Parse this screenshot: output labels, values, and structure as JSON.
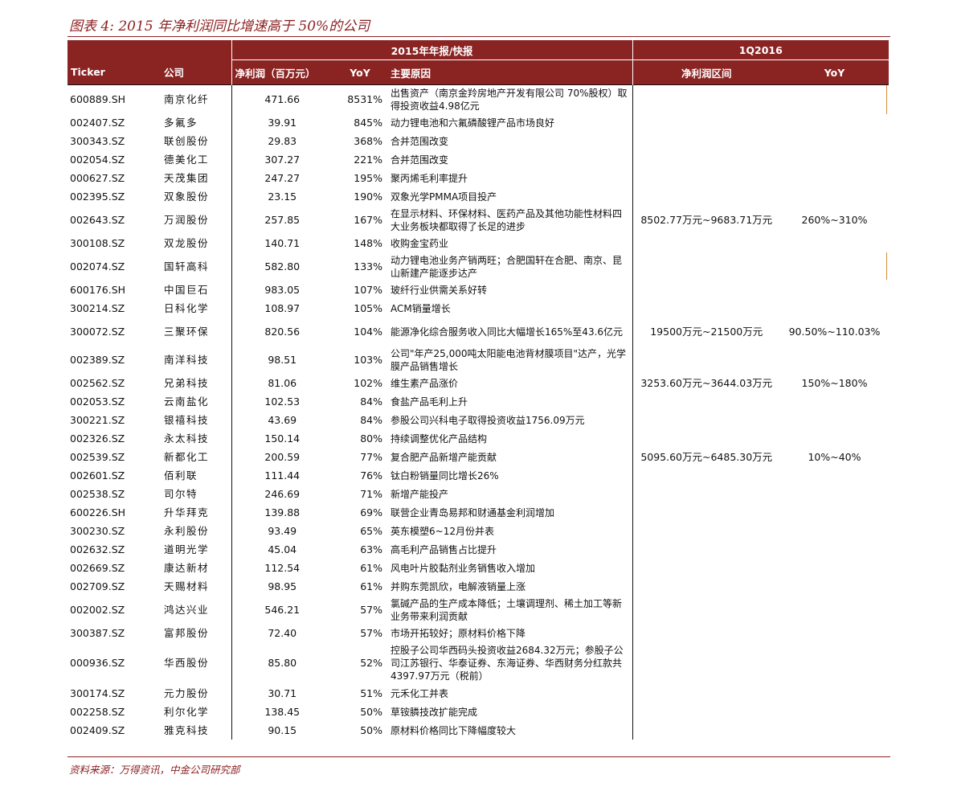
{
  "title": "图表 4: 2015 年净利润同比增速高于 50%的公司",
  "header": {
    "group_2015": "2015年年报/快报",
    "group_1q2016": "1Q2016",
    "col_ticker": "Ticker",
    "col_company": "公司",
    "col_net_profit": "净利润（百万元）",
    "col_yoy": "YoY",
    "col_reason": "主要原因",
    "col_range": "净利润区间",
    "col_q1_yoy": "YoY"
  },
  "rows": [
    {
      "ticker": "600889.SH",
      "name": "南京化纤",
      "profit": "471.66",
      "yoy": "8531%",
      "reason": "出售资产（南京金羚房地产开发有限公司 70%股权）取得投资收益4.98亿元",
      "range": "",
      "q1yoy": ""
    },
    {
      "ticker": "002407.SZ",
      "name": "多氟多",
      "profit": "39.91",
      "yoy": "845%",
      "reason": "动力锂电池和六氟磷酸锂产品市场良好",
      "range": "",
      "q1yoy": ""
    },
    {
      "ticker": "300343.SZ",
      "name": "联创股份",
      "profit": "29.83",
      "yoy": "368%",
      "reason": "合并范围改变",
      "range": "",
      "q1yoy": ""
    },
    {
      "ticker": "002054.SZ",
      "name": "德美化工",
      "profit": "307.27",
      "yoy": "221%",
      "reason": "合并范围改变",
      "range": "",
      "q1yoy": ""
    },
    {
      "ticker": "000627.SZ",
      "name": "天茂集团",
      "profit": "247.27",
      "yoy": "195%",
      "reason": "聚丙烯毛利率提升",
      "range": "",
      "q1yoy": ""
    },
    {
      "ticker": "002395.SZ",
      "name": "双象股份",
      "profit": "23.15",
      "yoy": "190%",
      "reason": "双象光学PMMA项目投产",
      "range": "",
      "q1yoy": ""
    },
    {
      "ticker": "002643.SZ",
      "name": "万润股份",
      "profit": "257.85",
      "yoy": "167%",
      "reason": "在显示材料、环保材料、医药产品及其他功能性材料四大业务板块都取得了长足的进步",
      "range": "8502.77万元~9683.71万元",
      "q1yoy": "260%~310%"
    },
    {
      "ticker": "300108.SZ",
      "name": "双龙股份",
      "profit": "140.71",
      "yoy": "148%",
      "reason": "收购金宝药业",
      "range": "",
      "q1yoy": ""
    },
    {
      "ticker": "002074.SZ",
      "name": "国轩高科",
      "profit": "582.80",
      "yoy": "133%",
      "reason": "动力锂电池业务产销两旺；合肥国轩在合肥、南京、昆山新建产能逐步达产",
      "range": "",
      "q1yoy": ""
    },
    {
      "ticker": "600176.SH",
      "name": "中国巨石",
      "profit": "983.05",
      "yoy": "107%",
      "reason": "玻纤行业供需关系好转",
      "range": "",
      "q1yoy": ""
    },
    {
      "ticker": "300214.SZ",
      "name": "日科化学",
      "profit": "108.97",
      "yoy": "105%",
      "reason": "ACM销量增长",
      "range": "",
      "q1yoy": ""
    },
    {
      "ticker": "300072.SZ",
      "name": "三聚环保",
      "profit": "820.56",
      "yoy": "104%",
      "reason": "能源净化综合服务收入同比大幅增长165%至43.6亿元",
      "range": "19500万元~21500万元",
      "q1yoy": "90.50%~110.03%"
    },
    {
      "ticker": "002389.SZ",
      "name": "南洋科技",
      "profit": "98.51",
      "yoy": "103%",
      "reason": "公司\"年产25,000吨太阳能电池背材膜项目\"达产，光学膜产品销售增长",
      "range": "",
      "q1yoy": ""
    },
    {
      "ticker": "002562.SZ",
      "name": "兄弟科技",
      "profit": "81.06",
      "yoy": "102%",
      "reason": "维生素产品涨价",
      "range": "3253.60万元~3644.03万元",
      "q1yoy": "150%~180%"
    },
    {
      "ticker": "002053.SZ",
      "name": "云南盐化",
      "profit": "102.53",
      "yoy": "84%",
      "reason": "食盐产品毛利上升",
      "range": "",
      "q1yoy": ""
    },
    {
      "ticker": "300221.SZ",
      "name": "银禧科技",
      "profit": "43.69",
      "yoy": "84%",
      "reason": "参股公司兴科电子取得投资收益1756.09万元",
      "range": "",
      "q1yoy": ""
    },
    {
      "ticker": "002326.SZ",
      "name": "永太科技",
      "profit": "150.14",
      "yoy": "80%",
      "reason": "持续调整优化产品结构",
      "range": "",
      "q1yoy": ""
    },
    {
      "ticker": "002539.SZ",
      "name": "新都化工",
      "profit": "200.59",
      "yoy": "77%",
      "reason": "复合肥产品新增产能贡献",
      "range": "5095.60万元~6485.30万元",
      "q1yoy": "10%~40%"
    },
    {
      "ticker": "002601.SZ",
      "name": "佰利联",
      "profit": "111.44",
      "yoy": "76%",
      "reason": "钛白粉销量同比增长26%",
      "range": "",
      "q1yoy": ""
    },
    {
      "ticker": "002538.SZ",
      "name": "司尔特",
      "profit": "246.69",
      "yoy": "71%",
      "reason": "新增产能投产",
      "range": "",
      "q1yoy": ""
    },
    {
      "ticker": "600226.SH",
      "name": "升华拜克",
      "profit": "139.88",
      "yoy": "69%",
      "reason": "联营企业青岛易邦和财通基金利润增加",
      "range": "",
      "q1yoy": ""
    },
    {
      "ticker": "300230.SZ",
      "name": "永利股份",
      "profit": "93.49",
      "yoy": "65%",
      "reason": "英东模塑6~12月份并表",
      "range": "",
      "q1yoy": ""
    },
    {
      "ticker": "002632.SZ",
      "name": "道明光学",
      "profit": "45.04",
      "yoy": "63%",
      "reason": "高毛利产品销售占比提升",
      "range": "",
      "q1yoy": ""
    },
    {
      "ticker": "002669.SZ",
      "name": "康达新材",
      "profit": "112.54",
      "yoy": "61%",
      "reason": "风电叶片胶黏剂业务销售收入增加",
      "range": "",
      "q1yoy": ""
    },
    {
      "ticker": "002709.SZ",
      "name": "天赐材料",
      "profit": "98.95",
      "yoy": "61%",
      "reason": "并购东莞凯欣，电解液销量上涨",
      "range": "",
      "q1yoy": ""
    },
    {
      "ticker": "002002.SZ",
      "name": "鸿达兴业",
      "profit": "546.21",
      "yoy": "57%",
      "reason": "氯碱产品的生产成本降低；土壤调理剂、稀土加工等新业务带来利润贡献",
      "range": "",
      "q1yoy": ""
    },
    {
      "ticker": "300387.SZ",
      "name": "富邦股份",
      "profit": "72.40",
      "yoy": "57%",
      "reason": "市场开拓较好；原材料价格下降",
      "range": "",
      "q1yoy": ""
    },
    {
      "ticker": "000936.SZ",
      "name": "华西股份",
      "profit": "85.80",
      "yoy": "52%",
      "reason": "控股子公司华西码头投资收益2684.32万元；参股子公司江苏银行、华泰证券、东海证券、华西财务分红款共4397.97万元（税前）",
      "range": "",
      "q1yoy": ""
    },
    {
      "ticker": "300174.SZ",
      "name": "元力股份",
      "profit": "30.71",
      "yoy": "51%",
      "reason": "元禾化工并表",
      "range": "",
      "q1yoy": ""
    },
    {
      "ticker": "002258.SZ",
      "name": "利尔化学",
      "profit": "138.45",
      "yoy": "50%",
      "reason": "草铵膦技改扩能完成",
      "range": "",
      "q1yoy": ""
    },
    {
      "ticker": "002409.SZ",
      "name": "雅克科技",
      "profit": "90.15",
      "yoy": "50%",
      "reason": "原材料价格同比下降幅度较大",
      "range": "",
      "q1yoy": ""
    }
  ],
  "source": "资料来源：万得资讯，中金公司研究部"
}
